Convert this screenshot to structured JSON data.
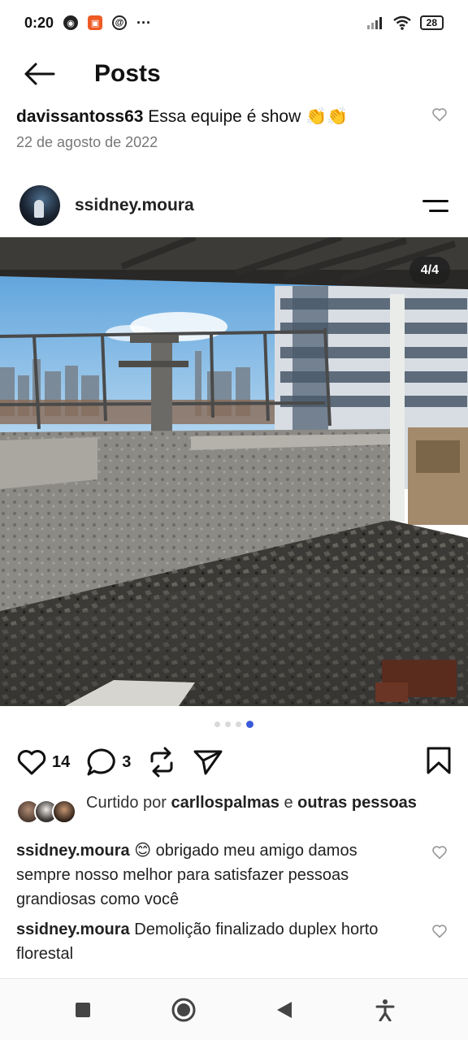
{
  "status": {
    "time": "0:20",
    "more": "···",
    "battery": "28"
  },
  "header": {
    "title": "Posts"
  },
  "previous_comment": {
    "username": "davissantoss63",
    "text": "Essa equipe é show 👏👏",
    "date": "22 de agosto de 2022"
  },
  "post": {
    "username": "ssidney.moura",
    "image_counter": "4/4",
    "total_images": 4,
    "current_image": 4,
    "like_count": "14",
    "comment_count": "3",
    "liked_by_prefix": "Curtido por",
    "liked_by_user": "carllospalmas",
    "liked_by_connector": "e",
    "liked_by_others": "outras pessoas"
  },
  "comments": [
    {
      "username": "ssidney.moura",
      "text": "😊 obrigado meu amigo damos sempre nosso melhor para satisfazer pessoas grandiosas como você"
    },
    {
      "username": "ssidney.moura",
      "text": "Demolição finalizado duplex horto florestal"
    }
  ],
  "icons": {
    "back": "arrow-left-icon",
    "like": "heart-icon",
    "comment": "speech-bubble-icon",
    "repost": "repost-icon",
    "share": "send-icon",
    "save": "bookmark-icon",
    "nav_recents": "square-icon",
    "nav_home": "circle-icon",
    "nav_back": "triangle-back-icon",
    "nav_accessibility": "accessibility-icon"
  },
  "colors": {
    "active_dot": "#3b5bdb",
    "sky": "#8fc3ea",
    "text_secondary": "#777777"
  }
}
